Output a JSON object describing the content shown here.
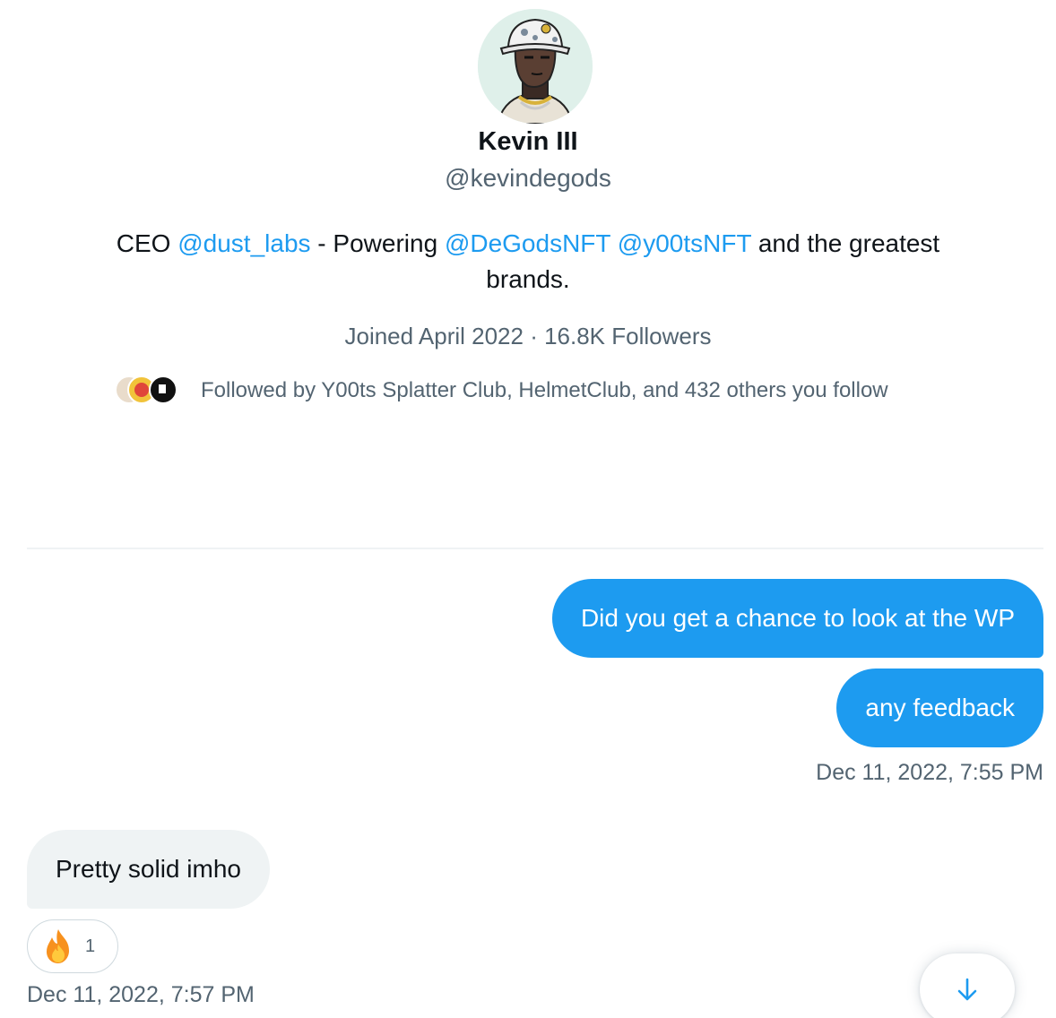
{
  "profile": {
    "display_name": "Kevin III",
    "handle": "@kevindegods",
    "bio": {
      "prefix": "CEO ",
      "mention_1": "@dust_labs",
      "middle": " - Powering ",
      "mention_2": "@DeGodsNFT",
      "space": " ",
      "mention_3": "@y00tsNFT",
      "suffix": " and the greatest brands."
    },
    "meta": "Joined April 2022 · 16.8K Followers",
    "followed_by": "Followed by Y00ts Splatter Club, HelmetClub, and 432 others you follow"
  },
  "messages": {
    "outgoing": [
      {
        "text": "Did you get a chance to look at the WP"
      },
      {
        "text": "any feedback"
      }
    ],
    "outgoing_time": "Dec 11, 2022, 7:55 PM",
    "incoming": {
      "text": "Pretty solid imho",
      "reaction": {
        "emoji": "fire-emoji",
        "count": "1"
      },
      "time": "Dec 11, 2022, 7:57 PM"
    }
  },
  "colors": {
    "accent": "#1d9bf0",
    "secondary_text": "#536471",
    "incoming_bubble": "#eff3f4"
  },
  "icons": {
    "scroll_down": "arrow-down-icon"
  }
}
